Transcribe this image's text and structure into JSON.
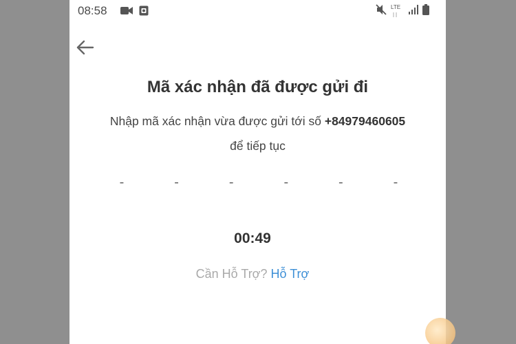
{
  "status_bar": {
    "time": "08:58",
    "network": "LTE",
    "icons": [
      "video-camera-icon",
      "screenshot-icon",
      "mute-icon",
      "signal-icon",
      "battery-icon"
    ]
  },
  "screen": {
    "title": "Mã xác nhận đã được gửi đi",
    "instruction_prefix": "Nhập mã xác nhận vừa được gửi tới số",
    "phone_number": "+84979460605",
    "instruction_suffix": "để tiếp tục",
    "code_slots": [
      "-",
      "-",
      "-",
      "-",
      "-",
      "-"
    ],
    "timer": "00:49",
    "help_prompt": "Cần Hỗ Trợ?",
    "help_link": "Hỗ Trợ"
  },
  "colors": {
    "background_border": "#8f8f8f",
    "screen_bg": "#ffffff",
    "link": "#3d8fd6",
    "muted_text": "#a9a9a9"
  }
}
